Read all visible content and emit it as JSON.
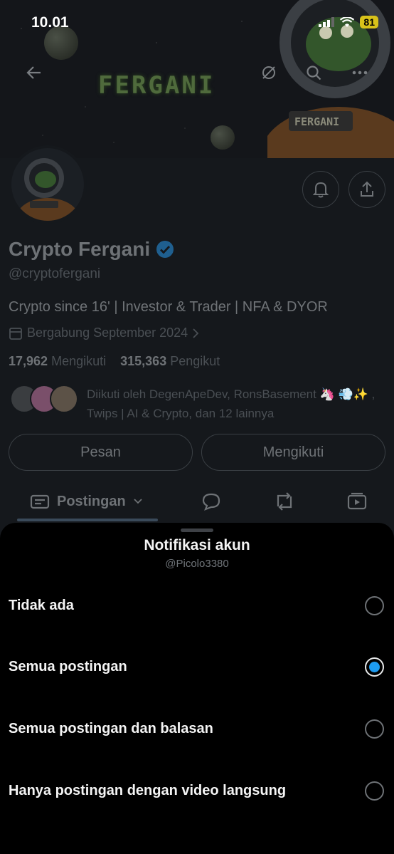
{
  "status_bar": {
    "time": "10.01",
    "battery": "81"
  },
  "banner": {
    "logo_text": "FERGANI"
  },
  "profile": {
    "name": "Crypto Fergani",
    "handle": "@cryptofergani",
    "bio": "Crypto since 16' | Investor & Trader | NFA & DYOR",
    "joined": "Bergabung September 2024",
    "following_count": "17,962",
    "following_label": "Mengikuti",
    "followers_count": "315,363",
    "followers_label": "Pengikut",
    "followed_by": "Diikuti oleh DegenApeDev, RonsBasement 🦄 💨✨ , Twips | AI & Crypto, dan 12 lainnya"
  },
  "actions": {
    "message": "Pesan",
    "following": "Mengikuti"
  },
  "tabs": {
    "posts": "Postingan"
  },
  "sheet": {
    "title": "Notifikasi akun",
    "subtitle": "@Picolo3380",
    "options": [
      {
        "label": "Tidak ada",
        "selected": false
      },
      {
        "label": "Semua postingan",
        "selected": true
      },
      {
        "label": "Semua postingan dan balasan",
        "selected": false
      },
      {
        "label": "Hanya postingan dengan video langsung",
        "selected": false
      }
    ]
  },
  "colors": {
    "accent": "#1d9bf0",
    "battery": "#d8c21a",
    "verified": "#1d9bf0"
  }
}
